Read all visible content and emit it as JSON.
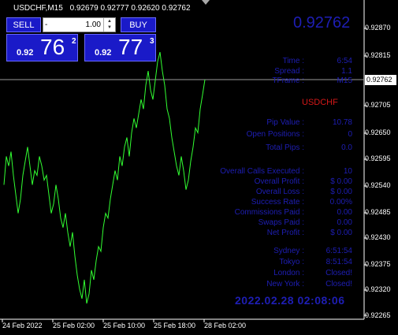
{
  "header": {
    "symbol": "USDCHF,M15",
    "ohlc": "0.92679 0.92777 0.92620 0.92762"
  },
  "big_price": "0.92762",
  "trade_panel": {
    "sell_label": "SELL",
    "buy_label": "BUY",
    "lot_minus": "-",
    "lot_value": "1.00",
    "sell_prefix": "0.92",
    "sell_main": "76",
    "sell_sup": "2",
    "buy_prefix": "0.92",
    "buy_main": "77",
    "buy_sup": "3"
  },
  "info": {
    "time_label": "Time :",
    "time_value": "6:54",
    "spread_label": "Spread :",
    "spread_value": "1.1",
    "tframe_label": "TFrame :",
    "tframe_value": "M15",
    "pair": "USDCHF",
    "pip_label": "Pip Value :",
    "pip_value": "10.78",
    "open_label": "Open Positions :",
    "open_value": "0",
    "pips_label": "Total Pips :",
    "pips_value": "0.0",
    "calls_label": "Overall Calls Executed :",
    "calls_value": "10",
    "profit_label": "Overall Profit :",
    "profit_value": "$ 0.00",
    "loss_label": "Overall Loss :",
    "loss_value": "$ 0.00",
    "rate_label": "Success Rate :",
    "rate_value": "0.00%",
    "comm_label": "Commissions Paid :",
    "comm_value": "0.00",
    "swap_label": "Swaps Paid :",
    "swap_value": "0.00",
    "net_label": "Net Profit :",
    "net_value": "$ 0.00",
    "sydney_label": "Sydney :",
    "sydney_value": "6:51:54",
    "tokyo_label": "Tokyo :",
    "tokyo_value": "8:51:54",
    "london_label": "London :",
    "london_value": "Closed!",
    "ny_label": "New York :",
    "ny_value": "Closed!",
    "clock": "2022.02.28 02:08:06"
  },
  "price_axis": [
    "0.92870",
    "0.92815",
    "0.92705",
    "0.92650",
    "0.92595",
    "0.92540",
    "0.92485",
    "0.92430",
    "0.92375",
    "0.92320",
    "0.92265"
  ],
  "price_current": "0.92762",
  "time_axis": [
    "24 Feb 2022",
    "25 Feb 02:00",
    "25 Feb 10:00",
    "25 Feb 18:00",
    "28 Feb 02:00"
  ],
  "colors": {
    "candle_line": "#32ff32",
    "panel_blue": "#1a1ac8",
    "text_blue": "#1e1eb4",
    "pair_red": "#d41818"
  },
  "chart_data": {
    "type": "line",
    "series": [
      {
        "values": [
          0.9254,
          0.926,
          0.9258,
          0.9261,
          0.9256,
          0.9252,
          0.9248,
          0.9251,
          0.9256,
          0.9259,
          0.9262,
          0.9258,
          0.9254,
          0.9257,
          0.9256,
          0.926,
          0.9258,
          0.9255,
          0.9256,
          0.9252,
          0.9248,
          0.925,
          0.9254,
          0.9251,
          0.9247,
          0.9245,
          0.9248,
          0.9244,
          0.9241,
          0.9244,
          0.9239,
          0.9235,
          0.9232,
          0.923,
          0.9234,
          0.9229,
          0.9231,
          0.9236,
          0.9234,
          0.9238,
          0.9241,
          0.924,
          0.9245,
          0.9248,
          0.9247,
          0.9251,
          0.9254,
          0.9257,
          0.9255,
          0.926,
          0.9258,
          0.9262,
          0.9264,
          0.926,
          0.9265,
          0.9268,
          0.9266,
          0.9269,
          0.9272,
          0.927,
          0.9275,
          0.9278,
          0.9274,
          0.9272,
          0.9276,
          0.928,
          0.9282,
          0.9278,
          0.9275,
          0.927,
          0.9268,
          0.9264,
          0.9261,
          0.9258,
          0.9256,
          0.926,
          0.9257,
          0.9253,
          0.9255,
          0.9259,
          0.9262,
          0.9266,
          0.9265,
          0.927,
          0.9273,
          0.92762
        ]
      }
    ]
  }
}
